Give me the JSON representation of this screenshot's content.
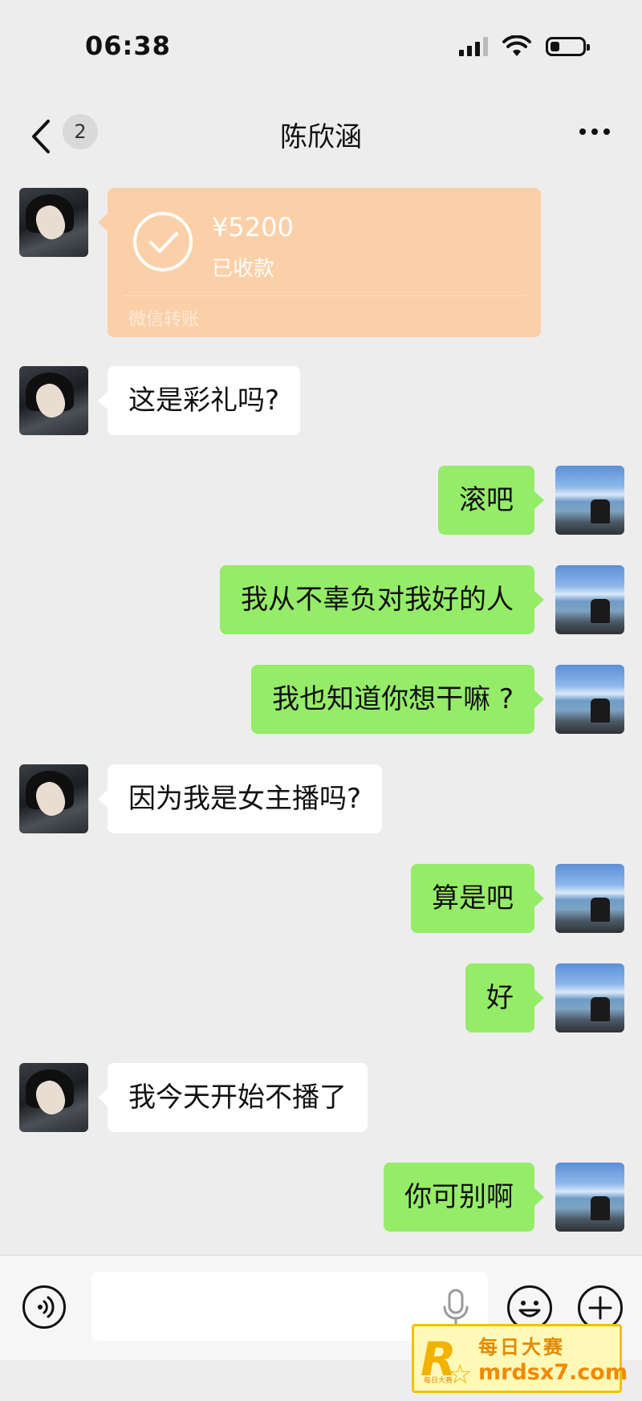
{
  "status_bar": {
    "time": "06:38",
    "icons": [
      "signal-icon",
      "wifi-icon",
      "battery-icon"
    ],
    "battery_level": 0.3
  },
  "header": {
    "back_icon": "chevron-left-icon",
    "unread_count": "2",
    "title": "陈欣涵",
    "more_icon": "ellipsis-icon"
  },
  "transfer": {
    "amount": "¥5200",
    "status": "已收款",
    "footer": "微信转账"
  },
  "messages": [
    {
      "side": "left",
      "text": "这是彩礼吗?"
    },
    {
      "side": "right",
      "text": "滚吧"
    },
    {
      "side": "right",
      "text": "我从不辜负对我好的人"
    },
    {
      "side": "right",
      "text": "我也知道你想干嘛 ?"
    },
    {
      "side": "left",
      "text": "因为我是女主播吗?"
    },
    {
      "side": "right",
      "text": "算是吧"
    },
    {
      "side": "right",
      "text": "好"
    },
    {
      "side": "left",
      "text": "我今天开始不播了"
    },
    {
      "side": "right",
      "text": "你可别啊"
    }
  ],
  "input_bar": {
    "voice_icon": "voice-icon",
    "placeholder": "",
    "mic_icon": "microphone-icon",
    "emoji_icon": "emoji-icon",
    "plus_icon": "plus-icon"
  },
  "watermark": {
    "logo": "R",
    "logo_sub": "每日大赛",
    "title": "每日大赛",
    "domain": "mrdsx7.com"
  },
  "colors": {
    "background": "#ededed",
    "sent_bubble": "#95ec69",
    "received_bubble": "#ffffff",
    "transfer_card": "#fbd0a8"
  }
}
